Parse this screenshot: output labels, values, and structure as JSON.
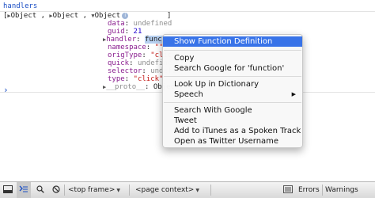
{
  "console": {
    "command": "handlers",
    "summary_open": "[",
    "summary_tri1": "▶",
    "summary_item1": "Object",
    "summary_comma1": ",",
    "summary_tri2": "▶",
    "summary_item2": "Object",
    "summary_comma2": ",",
    "summary_tri3": "▼",
    "summary_item3": "Object",
    "summary_close": "]",
    "info_icon": "i",
    "props": [
      {
        "name": "data",
        "value": "undefined"
      },
      {
        "name": "guid",
        "value": "21"
      },
      {
        "name": "handler",
        "value": "functi"
      },
      {
        "name": "namespace",
        "value": "\"\""
      },
      {
        "name": "origType",
        "value": "\"clic"
      },
      {
        "name": "quick",
        "value": "undefine"
      },
      {
        "name": "selector",
        "value": "undefi"
      },
      {
        "name": "type",
        "value": "\"click\""
      },
      {
        "name": "__proto__",
        "value": "Objec"
      }
    ],
    "prompt": "›"
  },
  "context_menu": {
    "items": [
      {
        "label": "Show Function Definition",
        "highlighted": true
      },
      {
        "label": "Copy"
      },
      {
        "label": "Search Google for 'function'"
      },
      {
        "label": "Look Up in Dictionary"
      },
      {
        "label": "Speech",
        "submenu": true
      },
      {
        "label": "Search With Google"
      },
      {
        "label": "Tweet"
      },
      {
        "label": "Add to iTunes as a Spoken Track"
      },
      {
        "label": "Open as Twitter Username"
      }
    ],
    "submenu_arrow": "▶"
  },
  "toolbar": {
    "frame_select": "<top frame>",
    "context_select": "<page context>",
    "errors_label": "Errors",
    "warnings_label": "Warnings",
    "caret": "▼"
  },
  "colors": {
    "accent": "#3873e8",
    "command_blue": "#1a4ec4",
    "property_purple": "#8a1e8f",
    "string_red": "#c41a16"
  }
}
